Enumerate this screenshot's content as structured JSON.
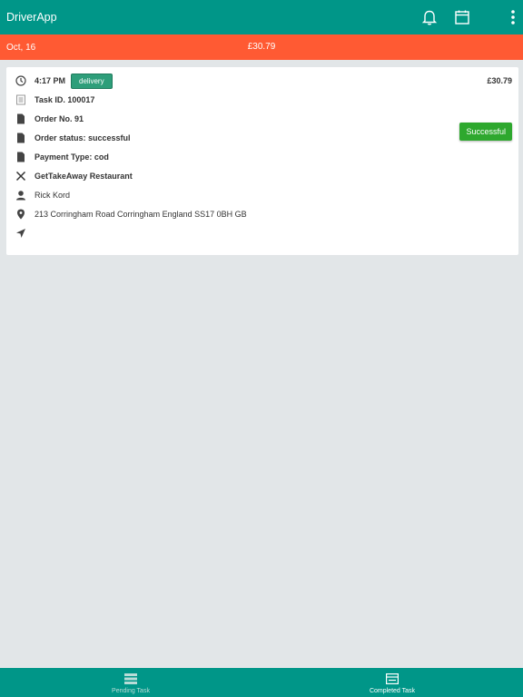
{
  "app": {
    "title": "DriverApp"
  },
  "header": {
    "icons": [
      "bell-icon",
      "calendar-icon",
      "more-vertical-icon"
    ]
  },
  "date_bar": {
    "date": "Oct, 16",
    "total": "£30.79"
  },
  "task": {
    "time": "4:17 PM",
    "type_badge": "delivery",
    "amount": "£30.79",
    "task_id": "Task ID. 100017",
    "order_no": "Order No. 91",
    "order_status": "Order status: successful",
    "payment_type": "Payment Type: cod",
    "restaurant": "GetTakeAway Restaurant",
    "customer": "Rick Kord",
    "address": "213 Corringham Road Corringham England SS17 0BH GB",
    "status_button": "Successful"
  },
  "tabs": [
    {
      "label": "Pending Task",
      "active": false
    },
    {
      "label": "Completed Task",
      "active": true
    }
  ],
  "colors": {
    "primary": "#009688",
    "date_bar": "#ff5a33",
    "success": "#2ea82e",
    "badge": "#2e9e7a",
    "background": "#e2e6e8"
  }
}
